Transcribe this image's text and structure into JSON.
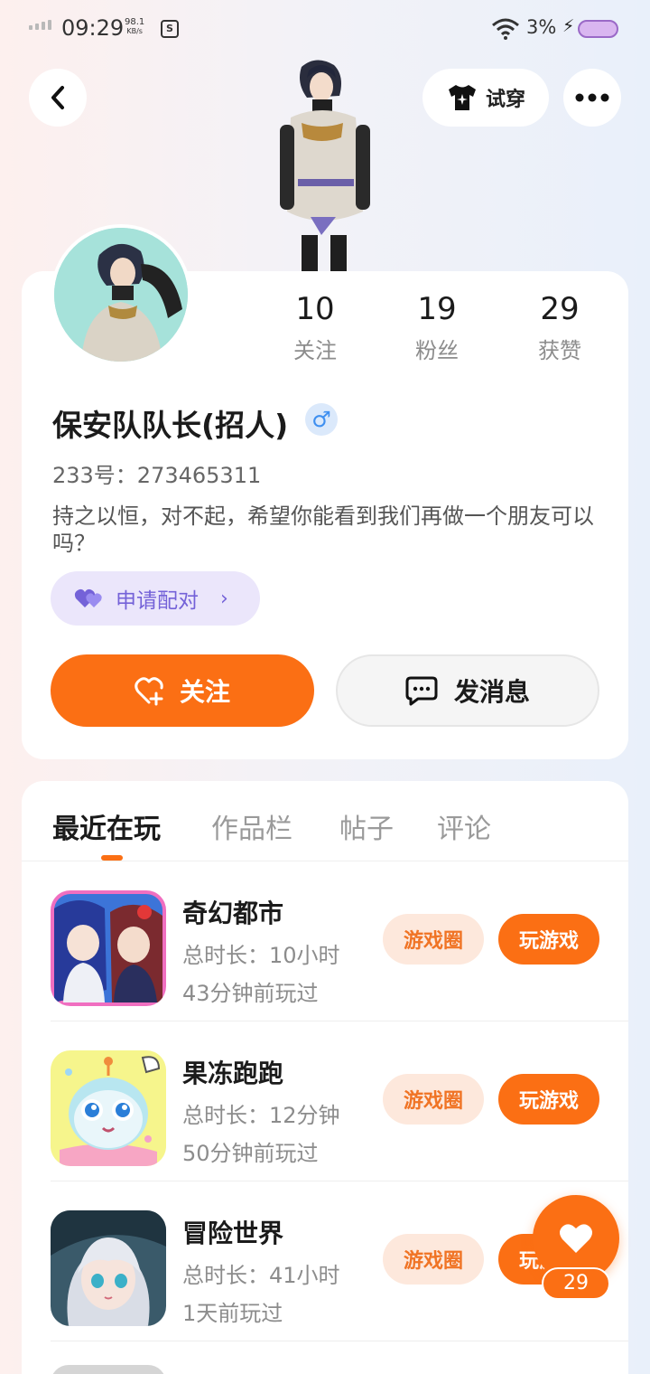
{
  "status_bar": {
    "time": "09:29",
    "speed_value": "98.1",
    "speed_unit": "KB/s",
    "battery": "3%",
    "icon_names": [
      "signal-icon",
      "notification-icon",
      "wifi-icon",
      "charging-icon",
      "battery-icon"
    ]
  },
  "header": {
    "try_on_label": "试穿"
  },
  "profile": {
    "stats": [
      {
        "value": "10",
        "label": "关注"
      },
      {
        "value": "19",
        "label": "粉丝"
      },
      {
        "value": "29",
        "label": "获赞"
      }
    ],
    "username": "保安队队长(招人)",
    "gender_symbol": "♂",
    "uid": "233号：273465311",
    "bio": "持之以恒，对不起，希望你能看到我们再做一个朋友可以吗？",
    "pair_label": "申请配对",
    "follow_label": "关注",
    "message_label": "发消息"
  },
  "tabs": [
    {
      "label": "最近在玩",
      "active": true
    },
    {
      "label": "作品栏",
      "active": false
    },
    {
      "label": "帖子",
      "active": false
    },
    {
      "label": "评论",
      "active": false
    }
  ],
  "games": [
    {
      "name": "奇幻都市",
      "total_time": "总时长：10小时",
      "last_played": "43分钟前玩过",
      "circle_label": "游戏圈",
      "play_label": "玩游戏"
    },
    {
      "name": "果冻跑跑",
      "total_time": "总时长：12分钟",
      "last_played": "50分钟前玩过",
      "circle_label": "游戏圈",
      "play_label": "玩游戏"
    },
    {
      "name": "冒险世界",
      "total_time": "总时长：41小时",
      "last_played": "1天前玩过",
      "circle_label": "游戏圈",
      "play_label": "玩游戏"
    }
  ],
  "like_fab": {
    "count": "29"
  },
  "colors": {
    "accent": "#fb6f14",
    "accent_light": "#fde8dc",
    "pair_bg": "#ebe6fb",
    "pair_text": "#7462d8",
    "gender_blue": "#3e8ff0"
  }
}
